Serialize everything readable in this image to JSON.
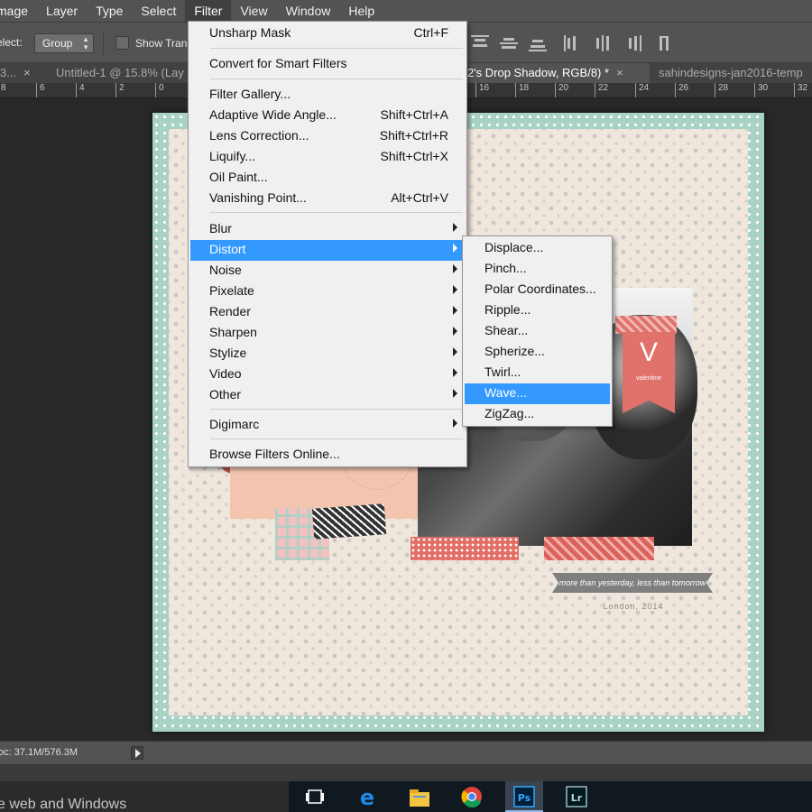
{
  "menubar": {
    "items": [
      "mage",
      "Layer",
      "Type",
      "Select",
      "Filter",
      "View",
      "Window",
      "Help"
    ],
    "active_index": 4
  },
  "options": {
    "select_label": "elect:",
    "group_value": "Group",
    "show_transform_label": "Show Tran"
  },
  "tabs": [
    {
      "label": "3...",
      "close": "×"
    },
    {
      "label": "Untitled-1 @ 15.8% (Lay",
      "close": ""
    },
    {
      "label": "r 2's Drop Shadow, RGB/8) *",
      "close": "×"
    },
    {
      "label": "sahindesigns-jan2016-temp",
      "close": ""
    }
  ],
  "ruler": {
    "ticks": [
      "8",
      "6",
      "4",
      "2",
      "0",
      "16",
      "18",
      "20",
      "22",
      "24",
      "26",
      "28",
      "30",
      "32"
    ]
  },
  "filter_menu": {
    "items": [
      {
        "label": "Unsharp Mask",
        "shortcut": "Ctrl+F"
      },
      {
        "label": "Convert for Smart Filters",
        "shortcut": ""
      },
      {
        "label": "Filter Gallery...",
        "shortcut": ""
      },
      {
        "label": "Adaptive Wide Angle...",
        "shortcut": "Shift+Ctrl+A"
      },
      {
        "label": "Lens Correction...",
        "shortcut": "Shift+Ctrl+R"
      },
      {
        "label": "Liquify...",
        "shortcut": "Shift+Ctrl+X"
      },
      {
        "label": "Oil Paint...",
        "shortcut": ""
      },
      {
        "label": "Vanishing Point...",
        "shortcut": "Alt+Ctrl+V"
      },
      {
        "label": "Blur",
        "shortcut": ""
      },
      {
        "label": "Distort",
        "shortcut": ""
      },
      {
        "label": "Noise",
        "shortcut": ""
      },
      {
        "label": "Pixelate",
        "shortcut": ""
      },
      {
        "label": "Render",
        "shortcut": ""
      },
      {
        "label": "Sharpen",
        "shortcut": ""
      },
      {
        "label": "Stylize",
        "shortcut": ""
      },
      {
        "label": "Video",
        "shortcut": ""
      },
      {
        "label": "Other",
        "shortcut": ""
      },
      {
        "label": "Digimarc",
        "shortcut": ""
      },
      {
        "label": "Browse Filters Online...",
        "shortcut": ""
      }
    ],
    "highlighted": "Distort"
  },
  "distort_submenu": {
    "items": [
      "Displace...",
      "Pinch...",
      "Polar Coordinates...",
      "Ripple...",
      "Shear...",
      "Spherize...",
      "Twirl...",
      "Wave...",
      "ZigZag..."
    ],
    "highlighted": "Wave..."
  },
  "artwork": {
    "tag_letter": "V",
    "tag_word": "valentine",
    "banner_text": "more than yesterday, less than tomorrow",
    "place_text": "London, 2014"
  },
  "status": {
    "doc_text": "oc: 37.1M/576.3M"
  },
  "taskbar": {
    "search_text": "e web and Windows",
    "apps": [
      {
        "icon": "task-view-icon",
        "label": ""
      },
      {
        "icon": "edge-icon",
        "label": ""
      },
      {
        "icon": "file-explorer-icon",
        "label": ""
      },
      {
        "icon": "chrome-icon",
        "label": ""
      },
      {
        "icon": "photoshop-icon",
        "label": "Ps"
      },
      {
        "icon": "lightroom-icon",
        "label": "Lr"
      }
    ]
  },
  "colors": {
    "highlight": "#3399ff",
    "ui_gray": "#535353",
    "border_mint": "#a9d2c6",
    "accent_red": "#e0716b"
  }
}
